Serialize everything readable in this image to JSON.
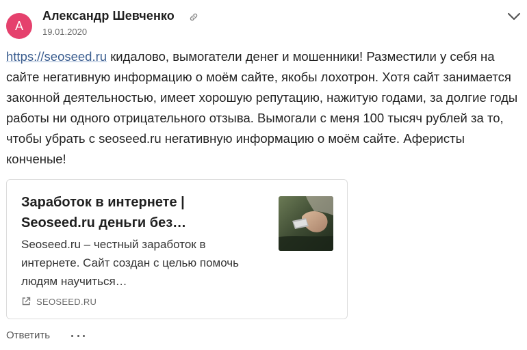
{
  "comment": {
    "avatar_letter": "А",
    "avatar_color": "#e5416d",
    "author_name": "Александр Шевченко",
    "author_link_icon": "link-icon",
    "date": "19.01.2020",
    "menu_icon": "chevron-down-icon",
    "text_link": "https://seoseed.ru",
    "text_body": " кидалово, вымогатели денег и мошенники! Разместили у себя на сайте негативную информацию о моём сайте, якобы лохотрон. Хотя сайт занимается законной деятельностью, имеет хорошую репутацию, нажитую годами, за долгие годы работы ни одного отрицательного отзыва. Вымогали с меня 100 тысяч рублей за то, чтобы убрать с seoseed.ru негативную информацию о моём сайте. Аферисты конченые!",
    "link_color": "#3a5d8f"
  },
  "link_preview": {
    "title": "Заработок в интернете | Seoseed.ru деньги без…",
    "description": "Seoseed.ru – честный заработок в интернете. Сайт создан с целью помочь людям научиться…",
    "domain_icon": "external-link-icon",
    "domain": "SEOSEED.RU"
  },
  "actions": {
    "reply_label": "Ответить",
    "more_icon": "more-dots-icon"
  }
}
